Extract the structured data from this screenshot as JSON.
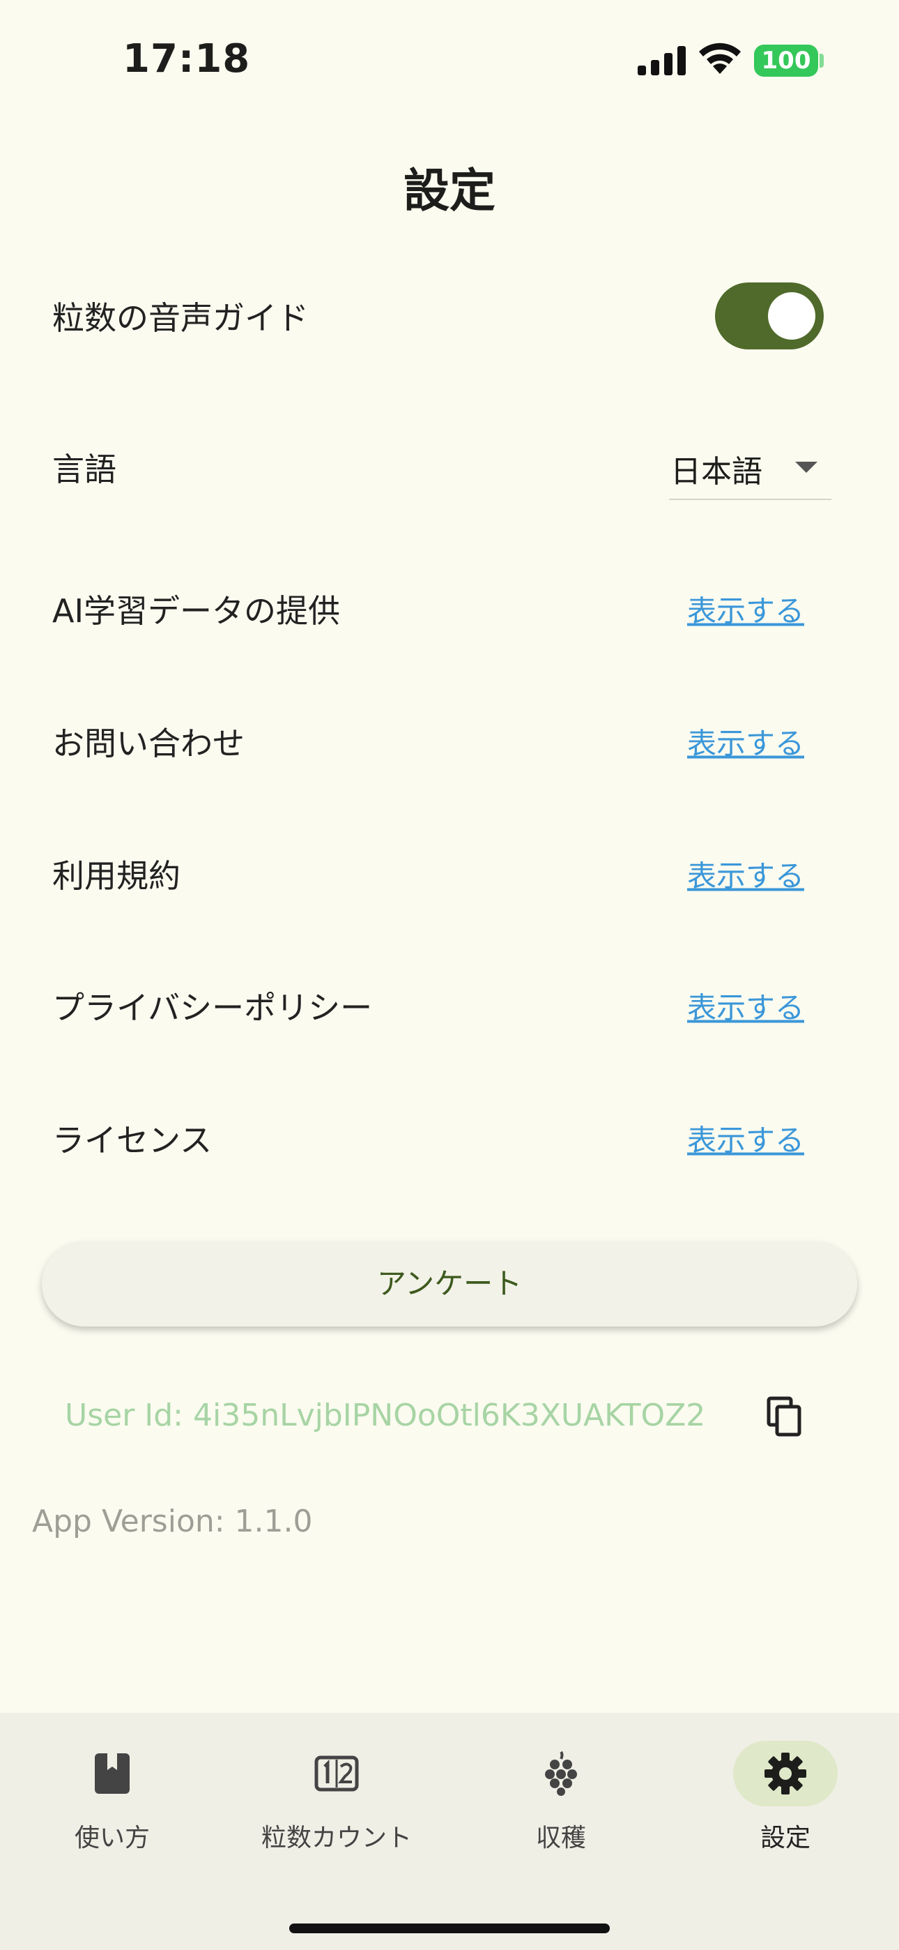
{
  "status_bar": {
    "time": "17:18",
    "battery": "100",
    "icons": [
      "signal-icon",
      "wifi-icon",
      "battery-icon"
    ]
  },
  "header": {
    "title": "設定"
  },
  "settings": {
    "voice_guide": {
      "label": "粒数の音声ガイド",
      "enabled": true
    },
    "language": {
      "label": "言語",
      "value": "日本語"
    },
    "links": [
      {
        "label": "AI学習データの提供",
        "action": "表示する"
      },
      {
        "label": "お問い合わせ",
        "action": "表示する"
      },
      {
        "label": "利用規約",
        "action": "表示する"
      },
      {
        "label": "プライバシーポリシー",
        "action": "表示する"
      },
      {
        "label": "ライセンス",
        "action": "表示する"
      }
    ]
  },
  "survey_button": {
    "label": "アンケート"
  },
  "user": {
    "id_text": "User Id: 4i35nLvjbIPNOoOtl6K3XUAKTOZ2"
  },
  "app": {
    "version_text": "App Version: 1.1.0"
  },
  "bottom_nav": {
    "items": [
      {
        "label": "使い方",
        "icon": "book-icon",
        "active": false
      },
      {
        "label": "粒数カウント",
        "icon": "counter-icon",
        "active": false
      },
      {
        "label": "収穫",
        "icon": "grape-icon",
        "active": false
      },
      {
        "label": "設定",
        "icon": "gear-icon",
        "active": true
      }
    ]
  },
  "colors": {
    "background": "#fbfbf0",
    "accent": "#4f6a2a",
    "link": "#3b97d9",
    "user_id": "#a7d4a4",
    "nav_active": "#dfe8c8"
  }
}
